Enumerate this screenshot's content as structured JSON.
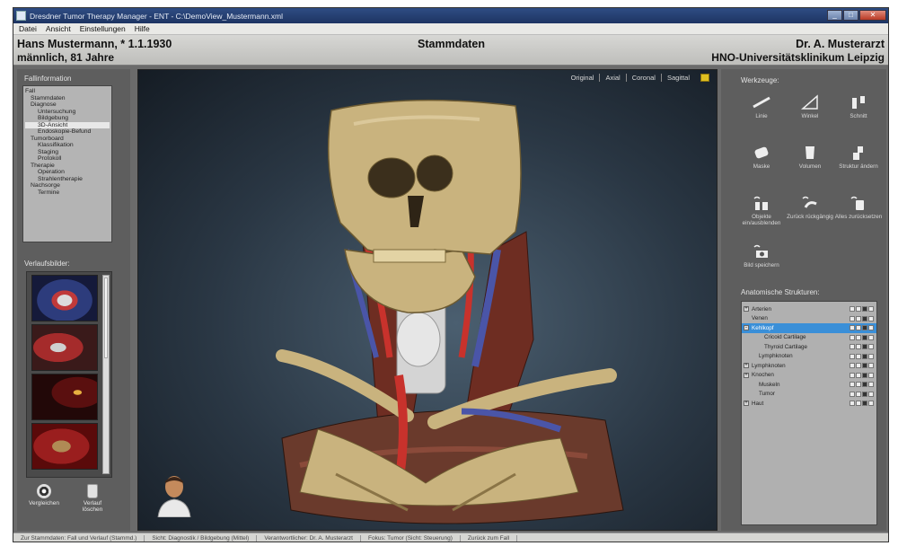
{
  "window": {
    "title": "Dresdner Tumor Therapy Manager - ENT - C:\\DemoView_Mustermann.xml",
    "min": "_",
    "max": "□",
    "close": "✕"
  },
  "menu": [
    "Datei",
    "Ansicht",
    "Einstellungen",
    "Hilfe"
  ],
  "header": {
    "patient_name": "Hans Mustermann, * 1.1.1930",
    "patient_info": "männlich, 81 Jahre",
    "view_title": "Stammdaten",
    "doctor_name": "Dr. A. Musterarzt",
    "clinic_name": "HNO-Universitätsklinikum Leipzig"
  },
  "left_panel": {
    "nav_label": "Fallinformation",
    "nav_tree": [
      {
        "label": "Fall",
        "level": 0
      },
      {
        "label": "Stammdaten",
        "level": 1
      },
      {
        "label": "Diagnose",
        "level": 1
      },
      {
        "label": "Untersuchung",
        "level": 2
      },
      {
        "label": "Bildgebung",
        "level": 2
      },
      {
        "label": "3D-Ansicht",
        "level": 2,
        "selected": true
      },
      {
        "label": "Endoskopie-Befund",
        "level": 2
      },
      {
        "label": "Tumorboard",
        "level": 1
      },
      {
        "label": "Klassifikation",
        "level": 2
      },
      {
        "label": "Staging",
        "level": 2
      },
      {
        "label": "Protokoll",
        "level": 2
      },
      {
        "label": "Therapie",
        "level": 1
      },
      {
        "label": "Operation",
        "level": 2
      },
      {
        "label": "Strahlentherapie",
        "level": 2
      },
      {
        "label": "Nachsorge",
        "level": 1
      },
      {
        "label": "Termine",
        "level": 2
      }
    ],
    "history_label": "Verlaufsbilder:",
    "history_items": [
      "CT axial",
      "3D-Ansicht",
      "Endoskopie",
      "Biopsie"
    ],
    "compare_label": "Vergleichen",
    "clear_label": "Verlauf löschen"
  },
  "viewport": {
    "modes": [
      "Original",
      "Axial",
      "Coronal",
      "Sagittal"
    ]
  },
  "right_panel": {
    "tools_label": "Werkzeuge:",
    "tools": [
      {
        "label": "Linie",
        "icon": "line-icon"
      },
      {
        "label": "Winkel",
        "icon": "angle-icon"
      },
      {
        "label": "Schnitt",
        "icon": "cut-icon"
      },
      {
        "label": "Maske",
        "icon": "mask-icon"
      },
      {
        "label": "Volumen",
        "icon": "volume-icon"
      },
      {
        "label": "Struktur ändern",
        "icon": "structure-edit-icon"
      },
      {
        "label": "Objekte ein/ausblenden",
        "icon": "visibility-icon"
      },
      {
        "label": "Zurück rückgängig",
        "icon": "undo-icon"
      },
      {
        "label": "Alles zurücksetzen",
        "icon": "reset-icon"
      },
      {
        "label": "Bild speichern",
        "icon": "screenshot-icon"
      }
    ],
    "structures_label": "Anatomische Strukturen:",
    "structures": [
      {
        "label": "Arterien",
        "level": 0,
        "expander": "+"
      },
      {
        "label": "Venen",
        "level": 0,
        "expander": ""
      },
      {
        "label": "Kehlkopf",
        "level": 0,
        "expander": "-",
        "selected": true
      },
      {
        "label": "Cricoid Cartilage",
        "level": 1,
        "expander": ""
      },
      {
        "label": "Thyroid Cartilage",
        "level": 1,
        "expander": ""
      },
      {
        "label": "Lymphknoten",
        "level": 0,
        "expander": ""
      },
      {
        "label": "Lymphknoten",
        "level": 0,
        "expander": "+"
      },
      {
        "label": "Knochen",
        "level": 0,
        "expander": "+"
      },
      {
        "label": "Muskeln",
        "level": 0,
        "expander": ""
      },
      {
        "label": "Tumor",
        "level": 0,
        "expander": ""
      },
      {
        "label": "Haut",
        "level": 0,
        "expander": "+"
      }
    ]
  },
  "statusbar": [
    "Zur Stammdaten: Fall und Verlauf (Stammd.)",
    "Sicht: Diagnostik / Bildgebung (Mittel)",
    "Verantwortlicher: Dr. A. Musterarzt",
    "Fokus: Tumor (Sicht: Steuerung)",
    "Zurück zum Fall"
  ],
  "colors": {
    "accent": "#3a8fd8",
    "bone": "#c9b37e",
    "artery": "#c8322c",
    "vein": "#4a55a8",
    "muscle": "#6e2d22"
  }
}
